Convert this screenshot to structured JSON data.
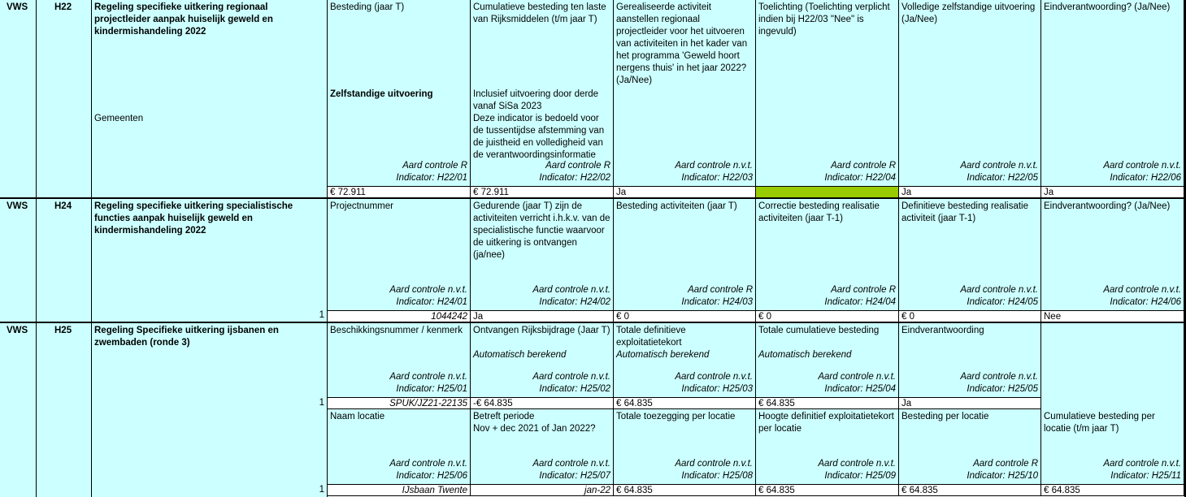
{
  "colors": {
    "cell_bg": "#ccffff",
    "input_bg": "#ffffff",
    "flag_green": "#99cc00"
  },
  "rows": {
    "h22": {
      "ministry": "VWS",
      "code": "H22",
      "title": "Regeling specifieke uitkering regionaal projectleider aanpak huiselijk geweld en kindermishandeling 2022",
      "recipient": "Gemeenten",
      "cols": [
        {
          "label": "Besteding (jaar T)",
          "note": "Zelfstandige uitvoering",
          "control": "Aard controle R",
          "indicator": "Indicator: H22/01",
          "value": "€ 72.911"
        },
        {
          "label": "Cumulatieve besteding ten laste van Rijksmiddelen (t/m jaar T)",
          "note": "Inclusief uitvoering door derde vanaf SiSa 2023\nDeze indicator is bedoeld voor de tussentijdse afstemming van de juistheid en volledigheid van de verantwoordingsinformatie",
          "control": "Aard controle R",
          "indicator": "Indicator: H22/02",
          "value": "€ 72.911"
        },
        {
          "label": "Gerealiseerde activiteit aanstellen regionaal projectleider voor het uitvoeren van activiteiten in het kader van het programma 'Geweld hoort nergens thuis' in het jaar 2022? (Ja/Nee)",
          "control": "Aard controle n.v.t.",
          "indicator": "Indicator: H22/03",
          "value": "Ja"
        },
        {
          "label": "Toelichting (Toelichting verplicht indien bij H22/03 \"Nee\" is ingevuld)",
          "control": "Aard controle R",
          "indicator": "Indicator: H22/04",
          "value": ""
        },
        {
          "label": "Volledige zelfstandige uitvoering (Ja/Nee)",
          "control": "Aard controle n.v.t.",
          "indicator": "Indicator: H22/05",
          "value": "Ja"
        },
        {
          "label": "Eindverantwoording? (Ja/Nee)",
          "control": "Aard controle n.v.t.",
          "indicator": "Indicator: H22/06",
          "value": "Ja"
        }
      ]
    },
    "h24": {
      "ministry": "VWS",
      "code": "H24",
      "title": "Regeling specifieke uitkering specialistische functies aanpak huiselijk geweld en kindermishandeling 2022",
      "row_no": "1",
      "cols": [
        {
          "label": "Projectnummer",
          "control": "Aard controle n.v.t.",
          "indicator": "Indicator: H24/01",
          "value": "1044242"
        },
        {
          "label": "Gedurende (jaar T) zijn de activiteiten verricht i.h.k.v. van de specialistische functie waarvoor de uitkering is ontvangen (ja/nee)",
          "control": "Aard controle n.v.t.",
          "indicator": "Indicator: H24/02",
          "value": "Ja"
        },
        {
          "label": "Besteding activiteiten (jaar T)",
          "control": "Aard controle R",
          "indicator": "Indicator: H24/03",
          "value": "€ 0"
        },
        {
          "label": "Correctie besteding realisatie activiteiten (jaar T-1)",
          "control": "Aard controle R",
          "indicator": "Indicator: H24/04",
          "value": "€ 0"
        },
        {
          "label": "Definitieve besteding realisatie activiteit (jaar T-1)",
          "control": "Aard controle n.v.t.",
          "indicator": "Indicator: H24/05",
          "value": "€ 0"
        },
        {
          "label": "Eindverantwoording? (Ja/Nee)",
          "control": "Aard controle n.v.t.",
          "indicator": "Indicator: H24/06",
          "value": "Nee"
        }
      ]
    },
    "h25": {
      "ministry": "VWS",
      "code": "H25",
      "title": "Regeling Specifieke uitkering ijsbanen en zwembaden (ronde 3)",
      "row_no_a": "1",
      "row_no_b": "1",
      "cols_a": [
        {
          "label": "Beschikkingsnummer / kenmerk",
          "control": "Aard controle n.v.t.",
          "indicator": "Indicator: H25/01",
          "value": "SPUK/JZ21-22135"
        },
        {
          "label": "Ontvangen Rijksbijdrage (Jaar T)",
          "note": "Automatisch berekend",
          "control": "Aard controle n.v.t.",
          "indicator": "Indicator: H25/02",
          "value": "-€ 64.835"
        },
        {
          "label": "Totale definitieve exploitatietekort",
          "note": "Automatisch berekend",
          "control": "Aard controle n.v.t.",
          "indicator": "Indicator: H25/03",
          "value": "€ 64.835"
        },
        {
          "label": "Totale cumulatieve besteding",
          "note": "Automatisch berekend",
          "control": "Aard controle n.v.t.",
          "indicator": "Indicator: H25/04",
          "value": "€ 64.835"
        },
        {
          "label": "Eindverantwoording",
          "control": "Aard controle n.v.t.",
          "indicator": "Indicator: H25/05",
          "value": "Ja"
        }
      ],
      "cols_b": [
        {
          "label": "Naam locatie",
          "control": "Aard controle n.v.t.",
          "indicator": "Indicator: H25/06",
          "value": "IJsbaan Twente"
        },
        {
          "label": "Betreft periode\nNov + dec 2021 of Jan 2022?",
          "control": "Aard controle n.v.t.",
          "indicator": "Indicator: H25/07",
          "value": "jan-22"
        },
        {
          "label": "Totale toezegging per locatie",
          "control": "Aard controle n.v.t.",
          "indicator": "Indicator: H25/08",
          "value": "€ 64.835"
        },
        {
          "label": "Hoogte definitief exploitatietekort per locatie",
          "control": "Aard controle n.v.t.",
          "indicator": "Indicator: H25/09",
          "value": "€ 64.835"
        },
        {
          "label": "Besteding per locatie",
          "control": "Aard controle R",
          "indicator": "Indicator: H25/10",
          "value": "€ 64.835"
        },
        {
          "label": "Cumulatieve besteding per locatie (t/m jaar T)",
          "control": "Aard controle n.v.t.",
          "indicator": "Indicator: H25/11",
          "value": "€ 64.835"
        }
      ]
    }
  }
}
